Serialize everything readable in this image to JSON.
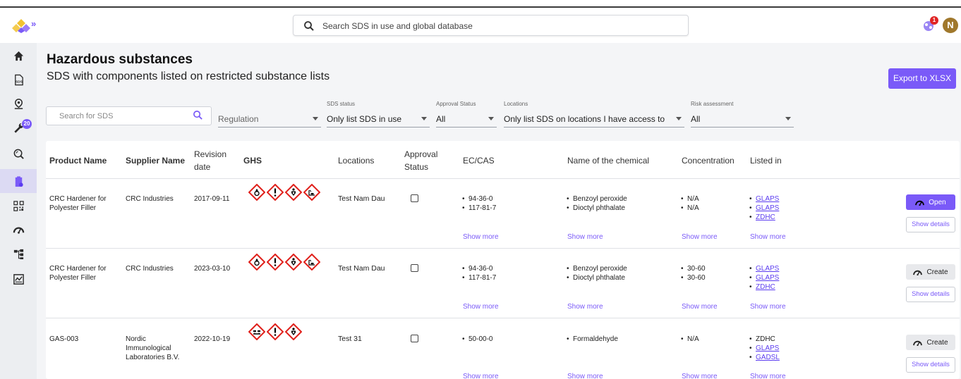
{
  "header": {
    "search_placeholder": "Search SDS in use and global database",
    "notification_count": "1",
    "avatar_initial": "N"
  },
  "sidebar": {
    "items": [
      {
        "icon": "home-icon"
      },
      {
        "icon": "sds-icon"
      },
      {
        "icon": "location-pin-icon"
      },
      {
        "icon": "wrench-icon",
        "badge": "20"
      },
      {
        "icon": "search-global-icon"
      },
      {
        "icon": "hazard-clipboard-icon",
        "active": true
      },
      {
        "icon": "qr-code-icon"
      },
      {
        "icon": "gauge-icon"
      },
      {
        "icon": "hierarchy-icon"
      },
      {
        "icon": "report-icon"
      }
    ]
  },
  "page": {
    "title": "Hazardous substances",
    "subtitle": "SDS with components listed on restricted substance lists",
    "export_label": "Export to XLSX"
  },
  "filters": {
    "search_placeholder": "Search for SDS",
    "regulation_placeholder": "Regulation",
    "sds_status_label": "SDS status",
    "sds_status_value": "Only list SDS in use",
    "approval_label": "Approval Status",
    "approval_value": "All",
    "locations_label": "Locations",
    "locations_value": "Only list SDS on locations I have access to",
    "risk_label": "Risk assessment",
    "risk_value": "All"
  },
  "table": {
    "headers": {
      "product": "Product Name",
      "supplier": "Supplier Name",
      "revision": "Revision date",
      "ghs": "GHS",
      "locations": "Locations",
      "approval": "Approval Status",
      "eccas": "EC/CAS",
      "chemical": "Name of the chemical",
      "concentration": "Concentration",
      "listed": "Listed in"
    },
    "show_more": "Show more",
    "show_details": "Show details",
    "rows": [
      {
        "product": "CRC Hardener for Polyester Filler",
        "supplier": "CRC Industries",
        "revision": "2017-09-11",
        "ghs": [
          "flame-over-circle-icon",
          "exclamation-icon",
          "health-hazard-icon",
          "environment-icon"
        ],
        "location": "Test Nam Dau",
        "eccas": [
          "94-36-0",
          "117-81-7"
        ],
        "chemicals": [
          "Benzoyl peroxide",
          "Dioctyl phthalate"
        ],
        "concentrations": [
          "N/A",
          "N/A"
        ],
        "listed": [
          "GLAPS",
          "GLAPS",
          "ZDHC"
        ],
        "action": "Open"
      },
      {
        "product": "CRC Hardener for Polyester Filler",
        "supplier": "CRC Industries",
        "revision": "2023-03-10",
        "ghs": [
          "flame-over-circle-icon",
          "exclamation-icon",
          "health-hazard-icon",
          "environment-icon"
        ],
        "location": "Test Nam Dau",
        "eccas": [
          "94-36-0",
          "117-81-7"
        ],
        "chemicals": [
          "Benzoyl peroxide",
          "Dioctyl phthalate"
        ],
        "concentrations": [
          "30-60",
          "30-60"
        ],
        "listed": [
          "GLAPS",
          "GLAPS",
          "ZDHC"
        ],
        "action": "Create"
      },
      {
        "product": "GAS-003",
        "supplier": "Nordic Immunological Laboratories B.V.",
        "revision": "2022-10-19",
        "ghs": [
          "corrosion-icon",
          "exclamation-icon",
          "health-hazard-icon"
        ],
        "location": "Test 31",
        "eccas": [
          "50-00-0"
        ],
        "chemicals": [
          "Formaldehyde"
        ],
        "concentrations": [
          "N/A"
        ],
        "listed": [
          "ZDHC",
          "GLAPS",
          "GADSL"
        ],
        "action": "Create"
      }
    ]
  }
}
